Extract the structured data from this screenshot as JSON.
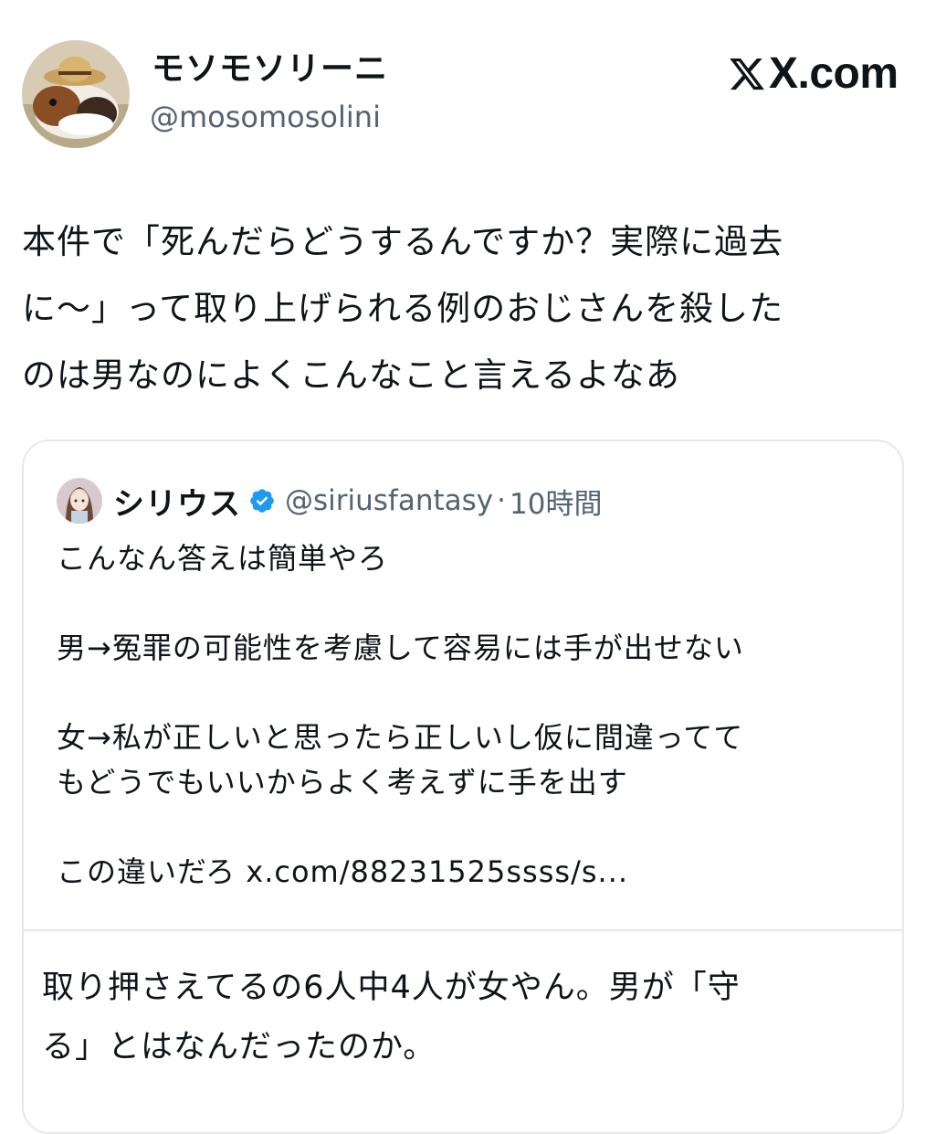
{
  "author": {
    "display_name": "モソモソリーニ",
    "handle": "@mosomosolini"
  },
  "brand": {
    "domain": "X.com",
    "icon": "x-logo-icon"
  },
  "tweet": {
    "lines": [
      "本件で「死んだらどうするんですか？実際に過去",
      "に〜」って取り上げられる例のおじさんを殺した",
      "のは男なのによくこんなこと言えるよなあ"
    ]
  },
  "quote": {
    "display_name": "シリウス",
    "verified_icon": "verified-badge-icon",
    "handle": "@siriusfantasy",
    "separator": "·",
    "time": "10時間",
    "lines": [
      "こんなん答えは簡単やろ",
      "",
      "男→冤罪の可能性を考慮して容易には手が出せない",
      "",
      "女→私が正しいと思ったら正しいし仮に間違ってて",
      "もどうでもいいからよく考えずに手を出す",
      ""
    ],
    "last_line_text": "この違いだろ ",
    "link": "x.com/88231525ssss/s...",
    "reply_lines": [
      "取り押さえてるの6人中4人が女やん。男が「守",
      "る」とはなんだったのか。"
    ]
  },
  "colors": {
    "text": "#0f1419",
    "secondary_text": "#536471",
    "border": "#e6e9ec",
    "verified": "#1d9bf0"
  }
}
